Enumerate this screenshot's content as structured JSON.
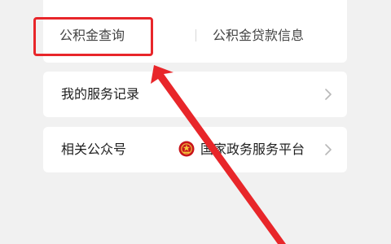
{
  "service_card": {
    "tab_query_label": "公积金查询",
    "tab_loan_label": "公积金贷款信息"
  },
  "records_row": {
    "label": "我的服务记录"
  },
  "accounts_row": {
    "label": "相关公众号",
    "platform_name": "国家政务服务平台"
  },
  "icons": {
    "chevron": "chevron-right-icon",
    "emblem": "national-emblem-icon"
  },
  "colors": {
    "annotation": "#e8262a",
    "background": "#f1f1f1",
    "card": "#ffffff"
  }
}
